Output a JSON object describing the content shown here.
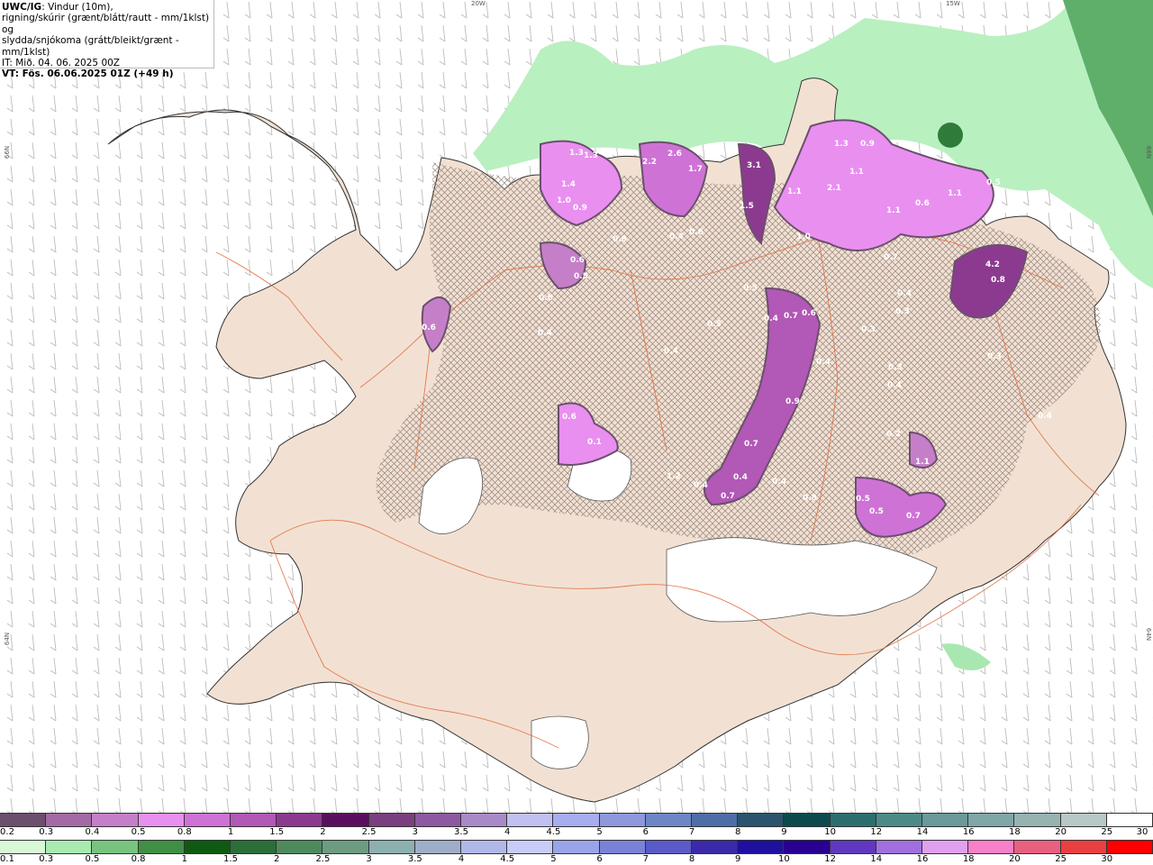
{
  "header": {
    "model": "UWC/IG",
    "line1": ": Vindur (10m),",
    "line2": "rigning/skúrir (grænt/blátt/rautt - mm/1klst) og",
    "line3": "slydda/snjókoma (grátt/bleikt/grænt - mm/1klst)",
    "init_time": "IT: Mið. 04. 06. 2025 00Z",
    "valid_time": "VT: Fös. 06.06.2025 01Z (+49 h)"
  },
  "grid_labels": {
    "top_left": "20W",
    "top_right": "15W",
    "left_upper": "66N",
    "left_lower": "64N",
    "right_upper": "66N",
    "right_lower": "64N"
  },
  "map_values": [
    "1.3",
    "1.3",
    "1.4",
    "2.2",
    "2.6",
    "1.7",
    "3.1",
    "1.3",
    "0.9",
    "1.1",
    "1.4",
    "1.0",
    "0.9",
    "2.1",
    "1.1",
    "0.6",
    "1.1",
    "0.5",
    "1.1",
    "0.6",
    "0.5",
    "0.6",
    "0.9",
    "0.4",
    "0.6",
    "1.5",
    "1.0",
    "0.8",
    "0.7",
    "0.4",
    "0.4",
    "0.6",
    "0.4",
    "0.5",
    "0.4",
    "0.5",
    "0.4",
    "0.7",
    "0.6",
    "0.3",
    "0.3",
    "0.4",
    "4.2",
    "0.3",
    "0.3",
    "0.4",
    "0.6",
    "0.1",
    "0.4",
    "0.9",
    "0.7",
    "0.2",
    "1.1",
    "0.4",
    "0.4",
    "0.5",
    "0.7",
    "0.8",
    "0.4",
    "0.5",
    "0.7",
    "1.2"
  ],
  "colorbar_snow": {
    "labels": [
      "0.2",
      "0.3",
      "0.4",
      "0.5",
      "0.8",
      "1",
      "1.5",
      "2",
      "2.5",
      "3",
      "3.5",
      "4",
      "4.5",
      "5",
      "6",
      "7",
      "8",
      "9",
      "10",
      "12",
      "14",
      "16",
      "18",
      "20",
      "25",
      "30"
    ],
    "colors": [
      "#6b4f6d",
      "#a36aa5",
      "#c57fc9",
      "#e98ff0",
      "#cf72d6",
      "#b258b6",
      "#8c3a90",
      "#5a0f5e",
      "#7a3f80",
      "#8e59a0",
      "#a88ac8",
      "#c2c0f0",
      "#a8acf0",
      "#8e98dc",
      "#6e86c8",
      "#4e6ea8",
      "#2c546f",
      "#0d4a4e",
      "#2c6e70",
      "#4c8a88",
      "#6a9a9a",
      "#7fa7a8",
      "#96b3b2",
      "#b7c8c6",
      "#ffffff"
    ]
  },
  "colorbar_rain": {
    "labels": [
      "0.1",
      "0.3",
      "0.5",
      "0.8",
      "1",
      "1.5",
      "2",
      "2.5",
      "3",
      "3.5",
      "4",
      "4.5",
      "5",
      "6",
      "7",
      "8",
      "9",
      "10",
      "12",
      "14",
      "16",
      "18",
      "20",
      "25",
      "30"
    ],
    "colors": [
      "#d8f8d8",
      "#a8eab0",
      "#78c47e",
      "#3f8f45",
      "#0f5a12",
      "#2c6e38",
      "#4e8a5c",
      "#6c9c82",
      "#8cb0b0",
      "#9eaec8",
      "#b0b8e8",
      "#c8ccf8",
      "#9aa4e8",
      "#7a82d8",
      "#5a5ac8",
      "#3a2aa8",
      "#1f10a0",
      "#2a0090",
      "#6038c0",
      "#a070e0",
      "#e0a0f0",
      "#f880c8",
      "#e86080",
      "#e84040",
      "#ff0000"
    ]
  }
}
